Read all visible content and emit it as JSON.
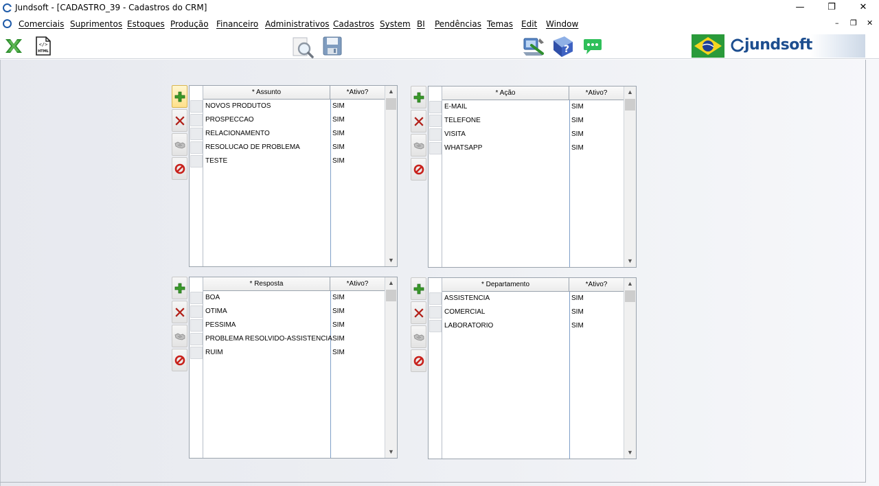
{
  "window": {
    "title": "Jundsoft - [CADASTRO_39 - Cadastros do CRM]",
    "controls": {
      "minimize": "—",
      "restore": "❐",
      "close": "✕"
    }
  },
  "menu": {
    "items": [
      "Comerciais",
      "Suprimentos",
      "Estoques",
      "Produção",
      "Financeiro",
      "Administrativos",
      "Cadastros",
      "System",
      "BI",
      "Pendências",
      "Temas",
      "Edit",
      "Window"
    ],
    "mdi_controls": {
      "minimize": "–",
      "restore": "❐",
      "close": "✕"
    }
  },
  "toolbar": {
    "icons": [
      "excel-icon",
      "html-icon",
      "preview-search-icon",
      "save-disk-icon",
      "tools-icon",
      "help-book-icon",
      "chat-icon",
      "brazil-flag-icon"
    ],
    "logo_text": "jundsoft",
    "html_icon_label": "HTML"
  },
  "panels": {
    "assunto": {
      "col1": "* Assunto",
      "col2": "*Ativo?",
      "rows": [
        {
          "name": "NOVOS PRODUTOS",
          "ativo": "SIM"
        },
        {
          "name": "PROSPECCAO",
          "ativo": "SIM"
        },
        {
          "name": "RELACIONAMENTO",
          "ativo": "SIM"
        },
        {
          "name": "RESOLUCAO DE PROBLEMA",
          "ativo": "SIM"
        },
        {
          "name": "TESTE",
          "ativo": "SIM"
        }
      ]
    },
    "acao": {
      "col1": "* Ação",
      "col2": "*Ativo?",
      "rows": [
        {
          "name": "E-MAIL",
          "ativo": "SIM"
        },
        {
          "name": "TELEFONE",
          "ativo": "SIM"
        },
        {
          "name": "VISITA",
          "ativo": "SIM"
        },
        {
          "name": "WHATSAPP",
          "ativo": "SIM"
        }
      ]
    },
    "resposta": {
      "col1": "* Resposta",
      "col2": "*Ativo?",
      "rows": [
        {
          "name": "BOA",
          "ativo": "SIM"
        },
        {
          "name": "OTIMA",
          "ativo": "SIM"
        },
        {
          "name": "PESSIMA",
          "ativo": "SIM"
        },
        {
          "name": "PROBLEMA RESOLVIDO-ASSISTENCIA",
          "ativo": "SIM"
        },
        {
          "name": "RUIM",
          "ativo": "SIM"
        }
      ]
    },
    "departamento": {
      "col1": "* Departamento",
      "col2": "*Ativo?",
      "rows": [
        {
          "name": "ASSISTENCIA",
          "ativo": "SIM"
        },
        {
          "name": "COMERCIAL",
          "ativo": "SIM"
        },
        {
          "name": "LABORATORIO",
          "ativo": "SIM"
        }
      ]
    }
  },
  "colors": {
    "add_green": "#3a9a2a",
    "delete_red": "#d8261c",
    "cancel_red": "#c8201a",
    "logo_blue": "#1d4e8f",
    "grid_border": "#9aa3ad"
  }
}
